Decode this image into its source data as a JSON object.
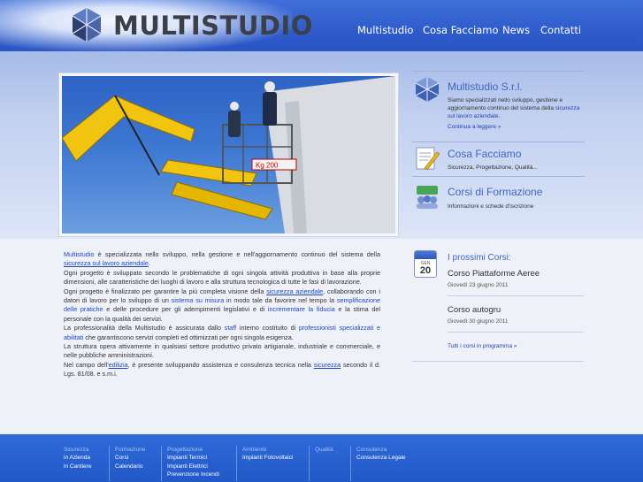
{
  "brand": {
    "name": "MULTISTUDIO"
  },
  "nav": [
    "Multistudio",
    "Cosa Facciamo",
    "News",
    "Contatti"
  ],
  "hero": {
    "photo_sign": "Kg 200"
  },
  "sidebar": [
    {
      "title": "Multistudio S.r.l.",
      "text": "Siamo specializzati nello sviluppo, gestione e aggiornamento continuo del sistema della ",
      "text_link": "sicurezza sul lavoro aziendale",
      "text_end": ".",
      "link": "Continua a leggere »",
      "icon": "cube-logo-icon"
    },
    {
      "title": "Cosa Facciamo",
      "text": "Sicurezza, Progettazione, Qualità...",
      "icon": "document-pen-icon"
    },
    {
      "title": "Corsi di Formazione",
      "text": "Informazioni e schede d'iscrizione",
      "icon": "people-group-icon"
    }
  ],
  "main_paragraph": [
    [
      {
        "t": "Multistudio",
        "c": "k"
      },
      {
        "t": " è specializzata nello sviluppo, nella gestione e nell'aggiornamento continuo del sistema della "
      },
      {
        "t": "sicurezza sul lavoro aziendale",
        "c": "u"
      },
      {
        "t": "."
      }
    ],
    [
      {
        "t": "Ogni progetto è sviluppato secondo le problematiche di ogni singola attività produttiva in base alla proprie dimensioni, alle caratteristiche dei luoghi di lavoro e alla struttura tecnologica di tutte le fasi di lavorazione."
      }
    ],
    [
      {
        "t": "Ogni progetto è finalizzato per garantire la più completa visione della "
      },
      {
        "t": "sicurezza aziendale",
        "c": "u"
      },
      {
        "t": ", collaborando con i datori di lavoro per lo sviluppo di un "
      },
      {
        "t": "sistema su misura",
        "c": "k"
      },
      {
        "t": " in modo tale da favorire nel tempo la "
      },
      {
        "t": "semplificazione delle pratiche",
        "c": "k"
      },
      {
        "t": " e delle procedure per gli adempimenti legislativi e di "
      },
      {
        "t": "incrementare la fiducia",
        "c": "k"
      },
      {
        "t": " e la stima del personale con la qualità dei servizi."
      }
    ],
    [
      {
        "t": "La professionalità della Multistudio è assicurata dallo "
      },
      {
        "t": "staff",
        "c": "k"
      },
      {
        "t": " interno costituito di "
      },
      {
        "t": "professionisti specializzati e abilitati",
        "c": "k"
      },
      {
        "t": " che garantiscono servizi completi ed ottimizzati per ogni singola esigenza."
      }
    ],
    [
      {
        "t": "La struttura opera attivamente in qualsiasi settore produttivo privato artigianale, industriale e commerciale, e nelle pubbliche amministrazioni."
      }
    ],
    [
      {
        "t": "Nel campo dell'"
      },
      {
        "t": "edilizia",
        "c": "u"
      },
      {
        "t": ", è presente sviluppando assistenza e consulenza tecnica nella "
      },
      {
        "t": "sicurezza",
        "c": "u"
      },
      {
        "t": " secondo il d. Lgs. 81/08. e s.m.i."
      }
    ]
  ],
  "courses": {
    "title": "I prossimi Corsi:",
    "calendar_month": "GEN",
    "calendar_day": "20",
    "items": [
      {
        "name": "Corso Piattaforme Aeree",
        "date": "Giovedì 23 giugno 2011"
      },
      {
        "name": "Corso autogru",
        "date": "Giovedì 30 giugno 2011"
      }
    ],
    "link": "Tutti i corsi in programma »"
  },
  "footer": [
    {
      "head": "Sicurezza",
      "items": [
        "in Azienda",
        "in Cantiere"
      ]
    },
    {
      "head": "Formazione",
      "items": [
        "Corsi",
        "Calendario"
      ]
    },
    {
      "head": "Progettazione",
      "items": [
        "Impianti Termici",
        "Impianti Elettrici",
        "Prevenzione Incendi"
      ]
    },
    {
      "head": "Ambiente",
      "items": [
        "Impianti Fotovoltaici"
      ]
    },
    {
      "head": "Qualità",
      "items": []
    },
    {
      "head": "Consulenza",
      "items": [
        "Consulenza Legale"
      ]
    }
  ]
}
